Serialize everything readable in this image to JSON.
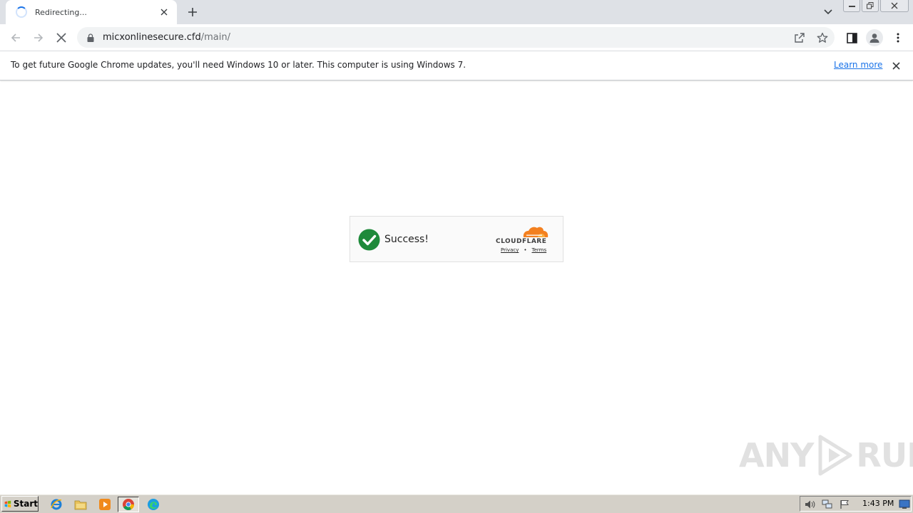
{
  "browser": {
    "tab": {
      "title": "Redirecting..."
    },
    "address_bar": {
      "host": "micxonlinesecure.cfd",
      "path": "/main/"
    },
    "infobar": {
      "message": "To get future Google Chrome updates, you'll need Windows 10 or later. This computer is using Windows 7.",
      "link_label": "Learn more"
    }
  },
  "page": {
    "widget": {
      "status": "Success!",
      "brand": "CLOUDFLARE",
      "links": [
        "Privacy",
        "Terms"
      ],
      "separator": "•"
    },
    "watermark": {
      "left": "ANY",
      "right": "RUN"
    }
  },
  "taskbar": {
    "start_label": "Start",
    "clock": "1:43 PM"
  },
  "colors": {
    "success_green": "#1f8a3b",
    "cloudflare_orange": "#f38020",
    "link_blue": "#1a73e8"
  }
}
